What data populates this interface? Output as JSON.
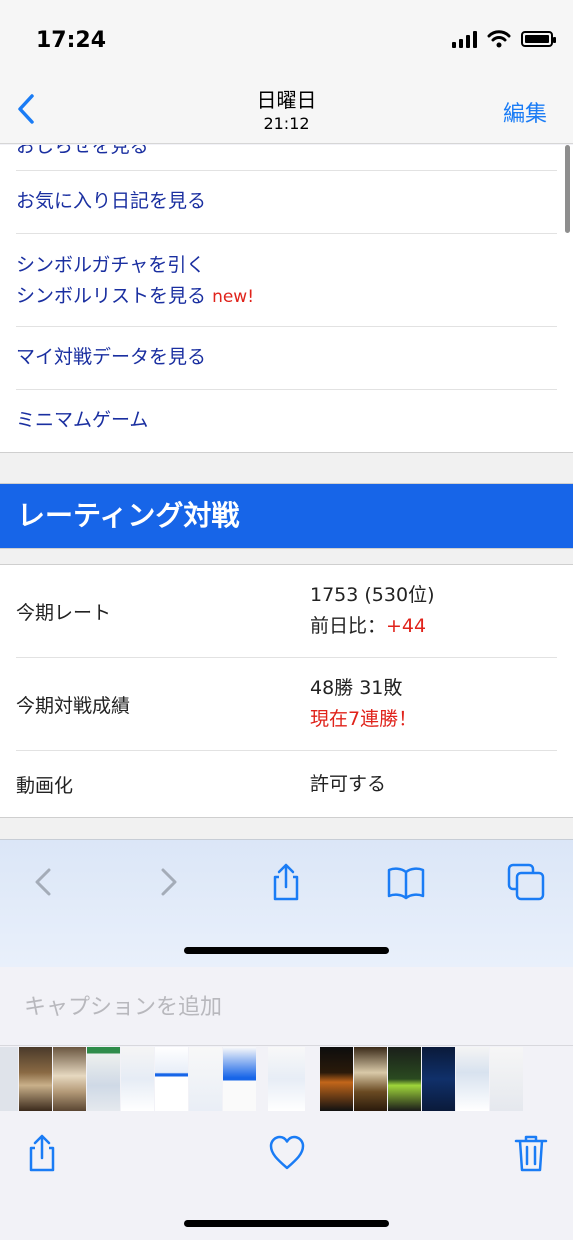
{
  "status_bar": {
    "time": "17:24"
  },
  "nav": {
    "title": "日曜日",
    "subtitle": "21:12",
    "edit_label": "編集"
  },
  "menu": {
    "partial_label": "おしらせを見る",
    "items": [
      {
        "label": "お気に入り日記を見る"
      },
      {
        "label_line1": "シンボルガチャを引く",
        "label_line2": "シンボルリストを見る",
        "badge": "new!"
      },
      {
        "label": "マイ対戦データを見る"
      },
      {
        "label": "ミニマムゲーム"
      }
    ]
  },
  "rating": {
    "heading": "レーティング対戦",
    "rows": [
      {
        "label": "今期レート",
        "value_line1": "1753 (530位)",
        "value_line2_prefix": "前日比：",
        "value_line2_delta": "+44"
      },
      {
        "label": "今期対戦成績",
        "value_line1": "48勝 31敗",
        "value_line2": "現在7連勝！"
      },
      {
        "label": "動画化",
        "value": "許可する"
      }
    ]
  },
  "caption": {
    "placeholder": "キャプションを追加"
  },
  "colors": {
    "link": "#1a2fa0",
    "accent": "#1a7cf5",
    "banner": "#1765e8",
    "highlight_red": "#e0231b"
  },
  "icons": {
    "safari_toolbar": [
      "back-icon",
      "forward-icon",
      "share-icon",
      "bookmarks-icon",
      "tabs-icon"
    ],
    "photo_toolbar": [
      "share-icon",
      "heart-icon",
      "trash-icon"
    ]
  }
}
